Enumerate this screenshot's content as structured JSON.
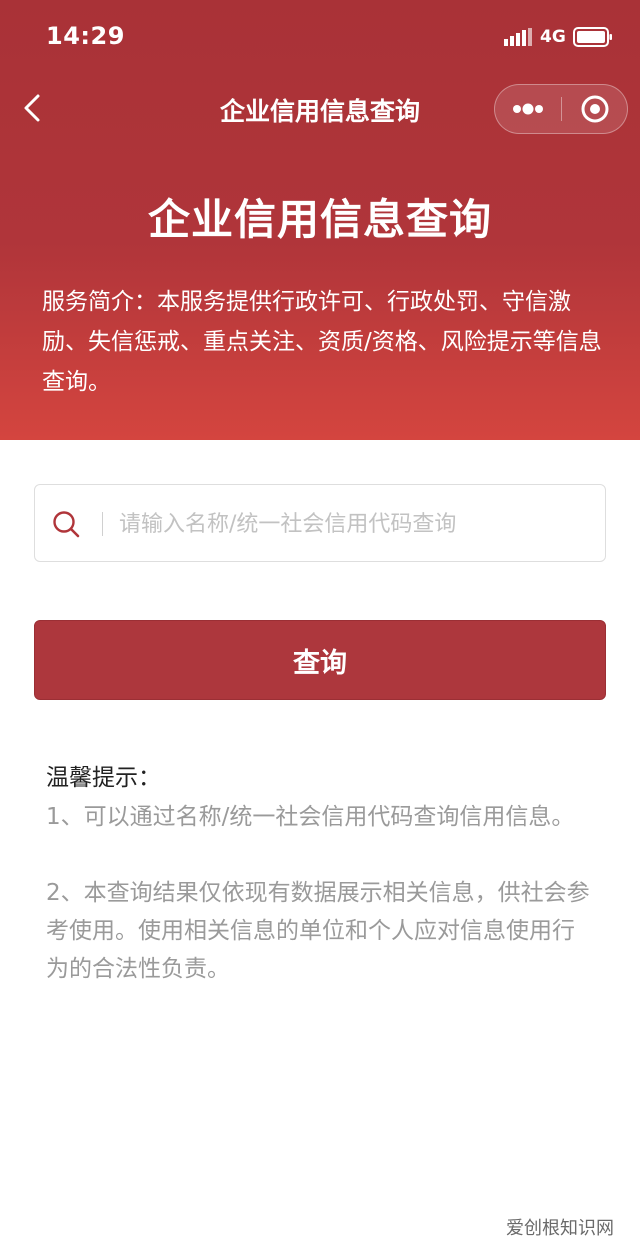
{
  "status_bar": {
    "time": "14:29",
    "network": "4G",
    "icons": [
      "signal-bars-icon",
      "battery-icon"
    ]
  },
  "nav": {
    "title": "企业信用信息查询",
    "icons": [
      "chevron-left-icon",
      "more-dots-icon",
      "target-circle-icon"
    ]
  },
  "hero": {
    "title": "企业信用信息查询",
    "description": "服务简介：本服务提供行政许可、行政处罚、守信激励、失信惩戒、重点关注、资质/资格、风险提示等信息查询。"
  },
  "search": {
    "placeholder": "请输入名称/统一社会信用代码查询",
    "value": "",
    "icon": "search-icon"
  },
  "query_button": {
    "label": "查询"
  },
  "tips": {
    "title": "温馨提示：",
    "items": [
      "1、可以通过名称/统一社会信用代码查询信用信息。",
      "2、本查询结果仅依现有数据展示相关信息，供社会参考使用。使用相关信息的单位和个人应对信息使用行为的合法性负责。"
    ]
  },
  "watermark": "爱创根知识网",
  "colors": {
    "header_red": "#a93237",
    "header_red_bottom": "#d4453f",
    "button_red": "#ad373d",
    "tip_gray": "#9a9a9a"
  }
}
